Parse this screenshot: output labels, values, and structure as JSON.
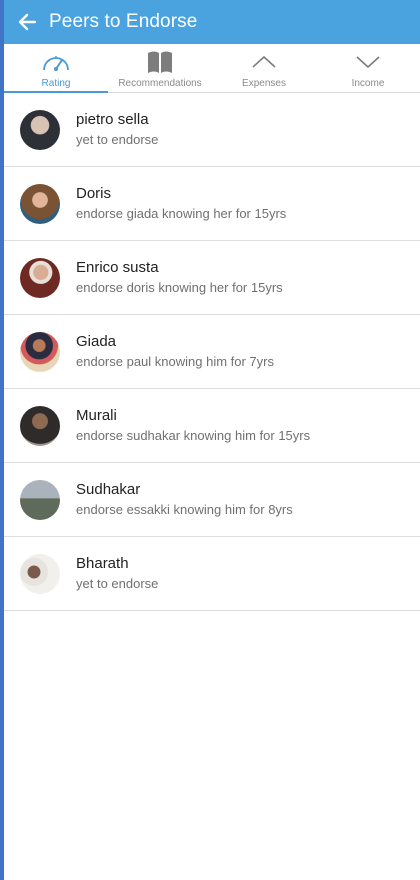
{
  "header": {
    "title": "Peers to Endorse",
    "back_icon": "arrow-left-icon"
  },
  "tabs": [
    {
      "label": "Rating",
      "icon": "speedometer-icon",
      "active": true
    },
    {
      "label": "Recommendations",
      "icon": "book-icon",
      "active": false
    },
    {
      "label": "Expenses",
      "icon": "chevron-up-icon",
      "active": false
    },
    {
      "label": "Income",
      "icon": "chevron-down-icon",
      "active": false
    }
  ],
  "peers": [
    {
      "name": "pietro sella",
      "status": "yet to endorse",
      "avatar_color": "#4a4f57"
    },
    {
      "name": "Doris",
      "status": "endorse giada knowing her for 15yrs",
      "avatar_color": "#8a6a4a"
    },
    {
      "name": "Enrico susta",
      "status": "endorse doris knowing her for 15yrs",
      "avatar_color": "#7a3b2c"
    },
    {
      "name": "Giada",
      "status": "endorse paul knowing him for 7yrs",
      "avatar_color": "#b57a5e"
    },
    {
      "name": "Murali",
      "status": "endorse sudhakar knowing him for 15yrs",
      "avatar_color": "#5a4e44"
    },
    {
      "name": "Sudhakar",
      "status": "endorse essakki knowing him for 8yrs",
      "avatar_color": "#8a8f8a"
    },
    {
      "name": "Bharath",
      "status": "yet to endorse",
      "avatar_color": "#c9c6c2"
    }
  ],
  "colors": {
    "header_bg": "#4aa3df",
    "accent": "#4a9ad8",
    "left_edge": "#3f74c6"
  }
}
